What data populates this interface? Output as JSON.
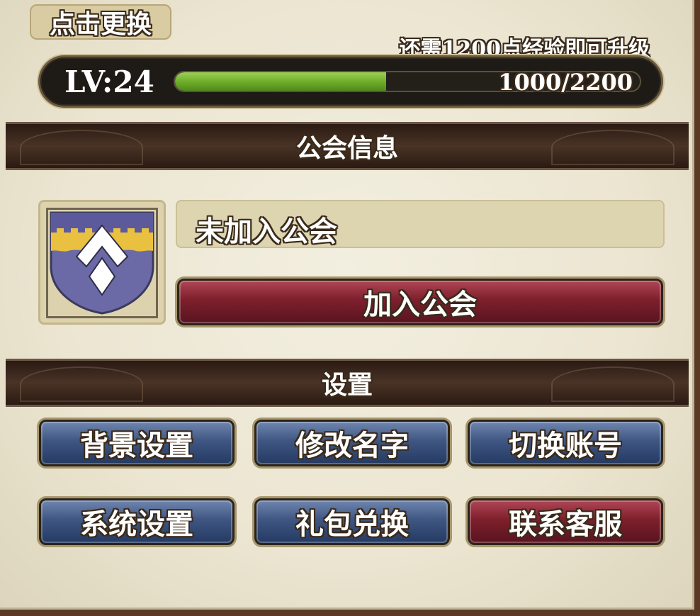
{
  "header": {
    "change_label": "点击更换",
    "exp_hint": "还需1200点经验即可升级"
  },
  "level": {
    "label": "LV:24",
    "exp_text": "1000/2200",
    "exp_progress": 0.4545
  },
  "guild": {
    "section_title": "公会信息",
    "name": "未加入公会",
    "join_label": "加入公会",
    "emblem_colors": {
      "top": "#5d5a9c",
      "band": "#e9c040",
      "body": "#6b6aa6",
      "chevron": "#ffffff"
    }
  },
  "settings": {
    "section_title": "设置",
    "buttons": [
      {
        "label": "背景设置",
        "style": "blue"
      },
      {
        "label": "修改名字",
        "style": "blue"
      },
      {
        "label": "切换账号",
        "style": "blue"
      },
      {
        "label": "系统设置",
        "style": "blue"
      },
      {
        "label": "礼包兑换",
        "style": "blue"
      },
      {
        "label": "联系客服",
        "style": "red"
      }
    ]
  }
}
